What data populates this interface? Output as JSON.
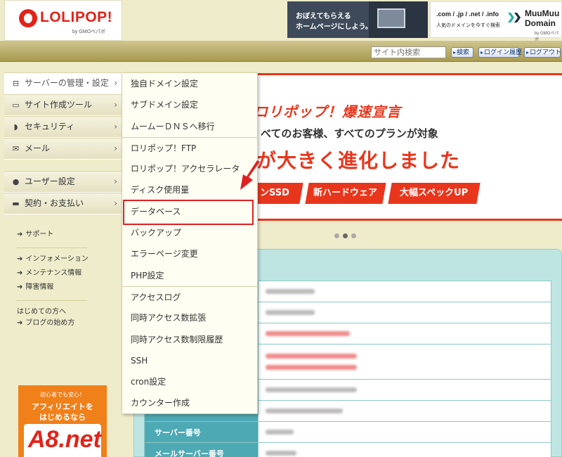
{
  "brand": {
    "logo_text": "LOLIPOP!",
    "logo_by": "by GMOペパボ"
  },
  "banners": {
    "hp": {
      "line1": "おぼえてもらえる",
      "line2": "ホームページにしよう。"
    },
    "muumuu": {
      "domains": ".com / .jp / .net / .info",
      "tagline": "人気のドメインを今すぐ検索",
      "name_line1": "MuuMuu",
      "name_line2": "Domain",
      "by": "by GMOペパボ"
    }
  },
  "toolbar": {
    "search_placeholder": "サイト内検索",
    "search_button": "検索",
    "login_history_button": "ログイン履歴",
    "logout_button": "ログアウト"
  },
  "sidebar": {
    "items": [
      {
        "label": "サーバーの管理・設定",
        "icon": "server-icon"
      },
      {
        "label": "サイト作成ツール",
        "icon": "laptop-icon"
      },
      {
        "label": "セキュリティ",
        "icon": "shield-icon"
      },
      {
        "label": "メール",
        "icon": "mail-icon"
      },
      {
        "label": "ユーザー設定",
        "icon": "user-icon"
      },
      {
        "label": "契約・お支払い",
        "icon": "card-icon"
      }
    ],
    "links": {
      "support": "サポート",
      "information": "インフォメーション",
      "maintenance": "メンテナンス情報",
      "trouble": "障害情報",
      "beginners": "はじめての方へ",
      "blog_start": "ブログの始め方"
    }
  },
  "affiliate_banner": {
    "line1": "初心者でも安心！",
    "line2": "アフィリエイトを",
    "line3": "はじめるなら",
    "logo": "A8.net"
  },
  "hero": {
    "title": "ロリポップ！爆速宣言",
    "sub": "べてのお客様、すべてのプランが対象",
    "main": "が大きく進化しました",
    "tags": [
      "ンSSD",
      "新ハードウェア",
      "大幅スペックUP"
    ]
  },
  "dropdown": {
    "items": [
      "独自ドメイン設定",
      "サブドメイン設定",
      "ムームーＤＮＳへ移行",
      "ロリポップ！FTP",
      "ロリポップ！アクセラレータ",
      "ディスク使用量",
      "データベース",
      "バックアップ",
      "エラーページ変更",
      "PHP設定",
      "アクセスログ",
      "同時アクセス数拡張",
      "同時アクセス数制限履歴",
      "SSH",
      "cron設定",
      "カウンター作成"
    ],
    "highlighted": "データベース"
  },
  "info_table": {
    "rows": [
      {
        "label": "サーバー番号"
      },
      {
        "label": "メールサーバー番号"
      }
    ]
  },
  "colors": {
    "accent_red": "#e8361d",
    "sidebar_bg": "#efeccb",
    "toolbar_olive": "#a89a4f",
    "table_teal": "#4da9b4"
  }
}
